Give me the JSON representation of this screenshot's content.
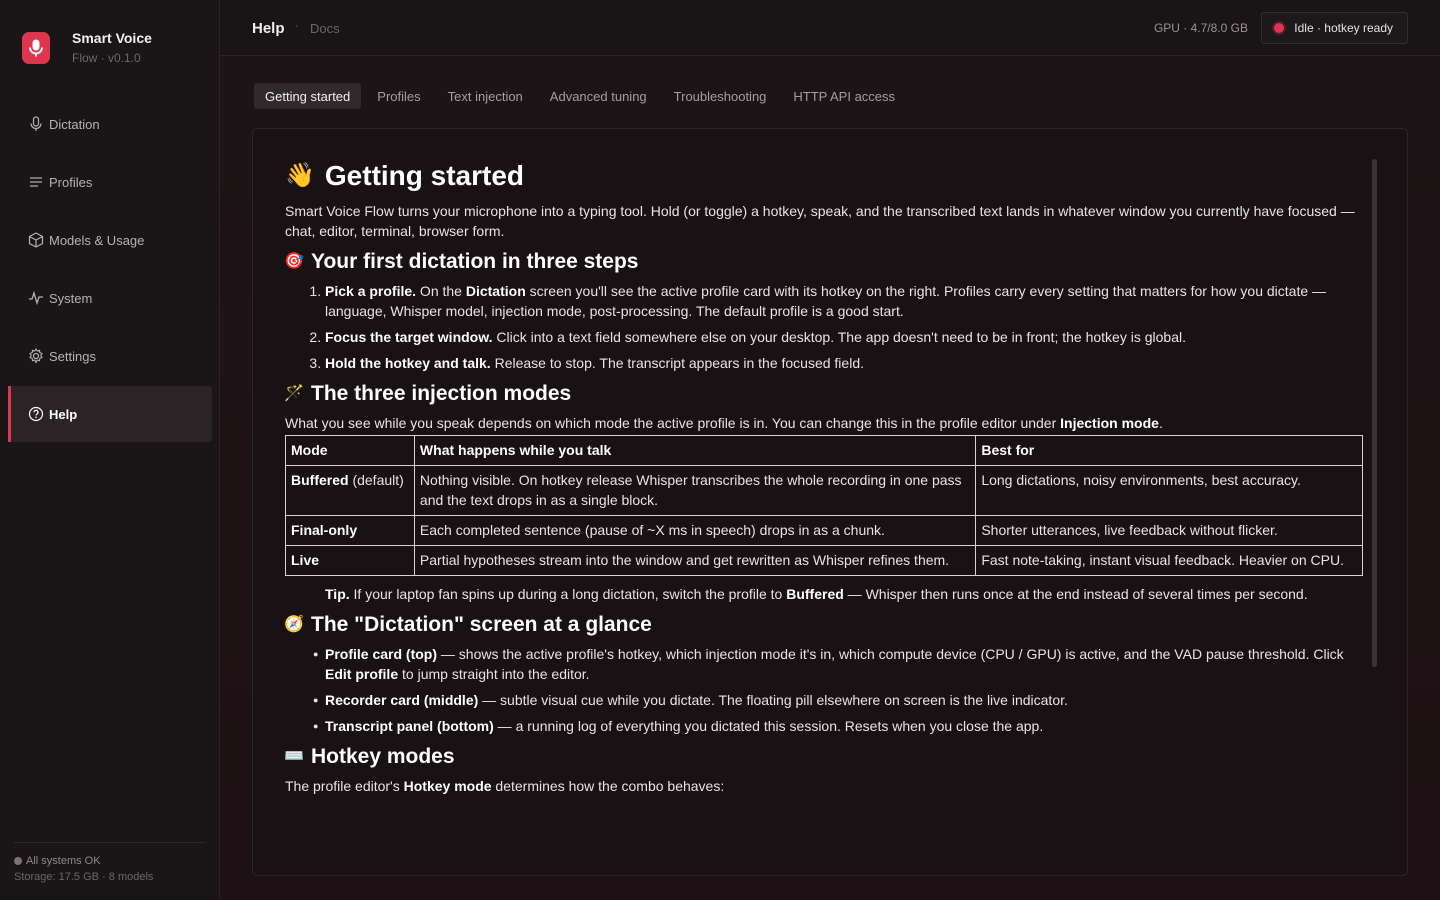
{
  "app": {
    "name": "Smart Voice",
    "version": "Flow · v0.1.0"
  },
  "sidebar": {
    "items": [
      {
        "label": "Dictation",
        "icon": "mic-icon"
      },
      {
        "label": "Profiles",
        "icon": "list-icon"
      },
      {
        "label": "Models & Usage",
        "icon": "cube-icon"
      },
      {
        "label": "System",
        "icon": "pulse-icon"
      },
      {
        "label": "Settings",
        "icon": "gear-icon"
      },
      {
        "label": "Help",
        "icon": "help-circle-icon",
        "active": true
      }
    ],
    "footer": {
      "status": "All systems OK",
      "storage": "Storage: 17.5 GB · 8 models"
    }
  },
  "topbar": {
    "title": "Help",
    "sep": "·",
    "subtitle": "Docs",
    "gpu": "GPU · 4.7/8.0 GB",
    "status": "Idle · hotkey ready"
  },
  "tabs": [
    "Getting started",
    "Profiles",
    "Text injection",
    "Advanced tuning",
    "Troubleshooting",
    "HTTP API access"
  ],
  "doc": {
    "h1": {
      "emoji": "👋",
      "text": "Getting started"
    },
    "intro": "Smart Voice Flow turns your microphone into a typing tool. Hold (or toggle) a hotkey, speak, and the transcribed text lands in whatever window you currently have focused — chat, editor, terminal, browser form.",
    "s1": {
      "emoji": "🎯",
      "title": "Your first dictation in three steps",
      "steps": [
        {
          "bold": "Pick a profile.",
          "pre": " On the ",
          "bold2": "Dictation",
          "post": " screen you'll see the active profile card with its hotkey on the right. Profiles carry every setting that matters for how you dictate — language, Whisper model, injection mode, post-processing. The default profile is a good start."
        },
        {
          "bold": "Focus the target window.",
          "post": " Click into a text field somewhere else on your desktop. The app doesn't need to be in front; the hotkey is global."
        },
        {
          "bold": "Hold the hotkey and talk.",
          "post": " Release to stop. The transcript appears in the focused field."
        }
      ]
    },
    "s2": {
      "emoji": "🪄",
      "title": "The three injection modes",
      "intro_pre": "What you see while you speak depends on which mode the active profile is in. You can change this in the profile editor under ",
      "intro_bold": "Injection mode",
      "intro_post": ".",
      "headers": [
        "Mode",
        "What happens while you talk",
        "Best for"
      ],
      "rows": [
        {
          "mode": "Buffered",
          "mode_suffix": " (default)",
          "what": "Nothing visible. On hotkey release Whisper transcribes the whole recording in one pass and the text drops in as a single block.",
          "best": "Long dictations, noisy environments, best accuracy."
        },
        {
          "mode": "Final-only",
          "mode_suffix": "",
          "what": "Each completed sentence (pause of ~X ms in speech) drops in as a chunk.",
          "best": "Shorter utterances, live feedback without flicker."
        },
        {
          "mode": "Live",
          "mode_suffix": "",
          "what": "Partial hypotheses stream into the window and get rewritten as Whisper refines them.",
          "best": "Fast note-taking, instant visual feedback. Heavier on CPU."
        }
      ],
      "tip_bold": "Tip.",
      "tip_pre": " If your laptop fan spins up during a long dictation, switch the profile to ",
      "tip_bold2": "Buffered",
      "tip_post": " — Whisper then runs once at the end instead of several times per second."
    },
    "s3": {
      "emoji": "🧭",
      "title": "The \"Dictation\" screen at a glance",
      "bullets": [
        {
          "bold": "Profile card (top)",
          "pre": " — shows the active profile's hotkey, which injection mode it's in, which compute device (CPU / GPU) is active, and the VAD pause threshold. Click ",
          "bold2": "Edit profile",
          "post": " to jump straight into the editor."
        },
        {
          "bold": "Recorder card (middle)",
          "pre": " — subtle visual cue while you dictate. The floating pill elsewhere on screen is the live indicator.",
          "bold2": "",
          "post": ""
        },
        {
          "bold": "Transcript panel (bottom)",
          "pre": " — a running log of everything you dictated this session. Resets when you close the app.",
          "bold2": "",
          "post": ""
        }
      ]
    },
    "s4": {
      "emoji": "⌨️",
      "title": "Hotkey modes",
      "intro_pre": "The profile editor's ",
      "intro_bold": "Hotkey mode",
      "intro_post": " determines how the combo behaves:"
    }
  }
}
